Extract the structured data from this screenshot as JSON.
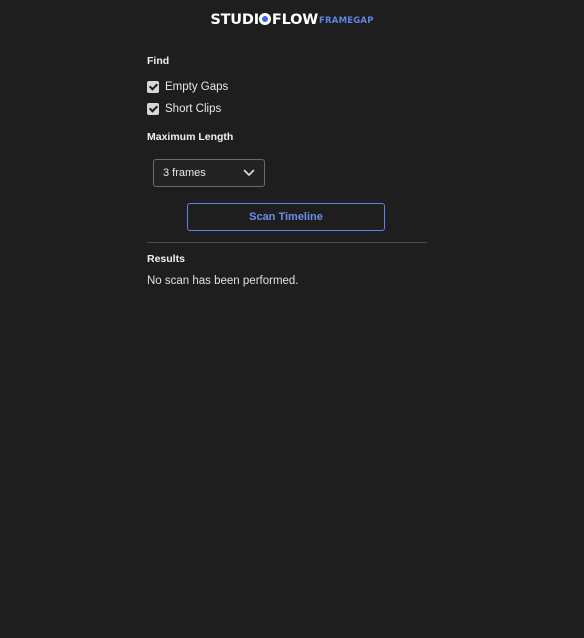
{
  "brand": {
    "name_part1": "STUDI",
    "name_part2": "FLOW",
    "product": "FRAMEGAP"
  },
  "find": {
    "title": "Find",
    "options": [
      {
        "label": "Empty Gaps",
        "checked": true
      },
      {
        "label": "Short Clips",
        "checked": true
      }
    ]
  },
  "max_length": {
    "title": "Maximum Length",
    "selected": "3 frames"
  },
  "scan": {
    "button_label": "Scan Timeline"
  },
  "results": {
    "title": "Results",
    "message": "No scan has been performed."
  },
  "colors": {
    "background": "#1e1e1e",
    "accent": "#6b8fe8",
    "brand_sub": "#5f86e0"
  }
}
